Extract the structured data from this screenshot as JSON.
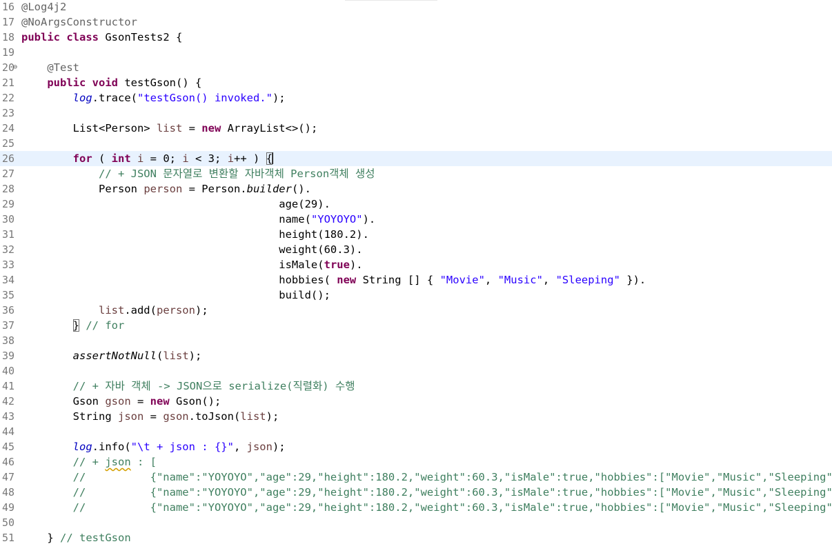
{
  "editor": {
    "lines": [
      {
        "num": "16",
        "tokens": [
          {
            "t": "@Log4j2",
            "c": "ann"
          }
        ]
      },
      {
        "num": "17",
        "tokens": [
          {
            "t": "@NoArgsConstructor",
            "c": "ann"
          }
        ]
      },
      {
        "num": "18",
        "tokens": [
          {
            "t": "public",
            "c": "kw"
          },
          {
            "t": " "
          },
          {
            "t": "class",
            "c": "kw"
          },
          {
            "t": " GsonTests2 {"
          }
        ]
      },
      {
        "num": "19",
        "tokens": []
      },
      {
        "num": "20",
        "fold": true,
        "tokens": [
          {
            "t": "    "
          },
          {
            "t": "@Test",
            "c": "ann"
          }
        ]
      },
      {
        "num": "21",
        "tokens": [
          {
            "t": "    "
          },
          {
            "t": "public",
            "c": "kw"
          },
          {
            "t": " "
          },
          {
            "t": "void",
            "c": "kw"
          },
          {
            "t": " testGson() {"
          }
        ]
      },
      {
        "num": "22",
        "tokens": [
          {
            "t": "        "
          },
          {
            "t": "log",
            "c": "fld"
          },
          {
            "t": ".trace("
          },
          {
            "t": "\"testGson() invoked.\"",
            "c": "str"
          },
          {
            "t": ");"
          }
        ]
      },
      {
        "num": "23",
        "tokens": []
      },
      {
        "num": "24",
        "tokens": [
          {
            "t": "        List<Person> "
          },
          {
            "t": "list",
            "c": "loc"
          },
          {
            "t": " = "
          },
          {
            "t": "new",
            "c": "kw"
          },
          {
            "t": " ArrayList<>();"
          }
        ]
      },
      {
        "num": "25",
        "tokens": []
      },
      {
        "num": "26",
        "current": true,
        "tokens": [
          {
            "t": "        "
          },
          {
            "t": "for",
            "c": "kw"
          },
          {
            "t": " ( "
          },
          {
            "t": "int",
            "c": "kw"
          },
          {
            "t": " "
          },
          {
            "t": "i",
            "c": "loc"
          },
          {
            "t": " = 0; "
          },
          {
            "t": "i",
            "c": "loc"
          },
          {
            "t": " < 3; "
          },
          {
            "t": "i",
            "c": "loc"
          },
          {
            "t": "++ ) "
          },
          {
            "t": "{",
            "c": "box"
          },
          {
            "t": "",
            "c": "caret"
          }
        ]
      },
      {
        "num": "27",
        "tokens": [
          {
            "t": "            "
          },
          {
            "t": "// + JSON 문자열로 변환할 자바객체 Person객체 생성",
            "c": "cmt"
          }
        ]
      },
      {
        "num": "28",
        "tokens": [
          {
            "t": "            Person "
          },
          {
            "t": "person",
            "c": "loc"
          },
          {
            "t": " = Person."
          },
          {
            "t": "builder",
            "c": "ital"
          },
          {
            "t": "()."
          }
        ]
      },
      {
        "num": "29",
        "tokens": [
          {
            "t": "                                        age(29)."
          }
        ]
      },
      {
        "num": "30",
        "tokens": [
          {
            "t": "                                        name("
          },
          {
            "t": "\"YOYOYO\"",
            "c": "str"
          },
          {
            "t": ")."
          }
        ]
      },
      {
        "num": "31",
        "tokens": [
          {
            "t": "                                        height(180.2)."
          }
        ]
      },
      {
        "num": "32",
        "tokens": [
          {
            "t": "                                        weight(60.3)."
          }
        ]
      },
      {
        "num": "33",
        "tokens": [
          {
            "t": "                                        isMale("
          },
          {
            "t": "true",
            "c": "kw"
          },
          {
            "t": ")."
          }
        ]
      },
      {
        "num": "34",
        "tokens": [
          {
            "t": "                                        hobbies( "
          },
          {
            "t": "new",
            "c": "kw"
          },
          {
            "t": " String [] { "
          },
          {
            "t": "\"Movie\"",
            "c": "str"
          },
          {
            "t": ", "
          },
          {
            "t": "\"Music\"",
            "c": "str"
          },
          {
            "t": ", "
          },
          {
            "t": "\"Sleeping\"",
            "c": "str"
          },
          {
            "t": " })."
          }
        ]
      },
      {
        "num": "35",
        "tokens": [
          {
            "t": "                                        build();"
          }
        ]
      },
      {
        "num": "36",
        "tokens": [
          {
            "t": "            "
          },
          {
            "t": "list",
            "c": "loc"
          },
          {
            "t": ".add("
          },
          {
            "t": "person",
            "c": "loc"
          },
          {
            "t": ");"
          }
        ]
      },
      {
        "num": "37",
        "tokens": [
          {
            "t": "        "
          },
          {
            "t": "}",
            "c": "box"
          },
          {
            "t": " "
          },
          {
            "t": "// for",
            "c": "cmt"
          }
        ]
      },
      {
        "num": "38",
        "tokens": []
      },
      {
        "num": "39",
        "tokens": [
          {
            "t": "        "
          },
          {
            "t": "assertNotNull",
            "c": "ital"
          },
          {
            "t": "("
          },
          {
            "t": "list",
            "c": "loc"
          },
          {
            "t": ");"
          }
        ]
      },
      {
        "num": "40",
        "tokens": []
      },
      {
        "num": "41",
        "tokens": [
          {
            "t": "        "
          },
          {
            "t": "// + 자바 객체 -> JSON으로 serialize(직렬화) 수행",
            "c": "cmt"
          }
        ]
      },
      {
        "num": "42",
        "tokens": [
          {
            "t": "        Gson "
          },
          {
            "t": "gson",
            "c": "loc"
          },
          {
            "t": " = "
          },
          {
            "t": "new",
            "c": "kw"
          },
          {
            "t": " Gson();"
          }
        ]
      },
      {
        "num": "43",
        "tokens": [
          {
            "t": "        String "
          },
          {
            "t": "json",
            "c": "loc"
          },
          {
            "t": " = "
          },
          {
            "t": "gson",
            "c": "loc"
          },
          {
            "t": ".toJson("
          },
          {
            "t": "list",
            "c": "loc"
          },
          {
            "t": ");"
          }
        ]
      },
      {
        "num": "44",
        "tokens": []
      },
      {
        "num": "45",
        "tokens": [
          {
            "t": "        "
          },
          {
            "t": "log",
            "c": "fld"
          },
          {
            "t": ".info("
          },
          {
            "t": "\"\\t + json : {}\"",
            "c": "str"
          },
          {
            "t": ", "
          },
          {
            "t": "json",
            "c": "loc"
          },
          {
            "t": ");"
          }
        ]
      },
      {
        "num": "46",
        "tokens": [
          {
            "t": "        "
          },
          {
            "t": "// + ",
            "c": "cmt"
          },
          {
            "t": "json",
            "c": "cmt squig"
          },
          {
            "t": " : [",
            "c": "cmt"
          }
        ]
      },
      {
        "num": "47",
        "tokens": [
          {
            "t": "        "
          },
          {
            "t": "//          {\"name\":\"YOYOYO\",\"age\":29,\"height\":180.2,\"weight\":60.3,\"isMale\":true,\"hobbies\":[\"Movie\",\"Music\",\"Sleeping\"]},",
            "c": "cmt"
          }
        ]
      },
      {
        "num": "48",
        "tokens": [
          {
            "t": "        "
          },
          {
            "t": "//          {\"name\":\"YOYOYO\",\"age\":29,\"height\":180.2,\"weight\":60.3,\"isMale\":true,\"hobbies\":[\"Movie\",\"Music\",\"Sleeping\"]},",
            "c": "cmt"
          }
        ]
      },
      {
        "num": "49",
        "tokens": [
          {
            "t": "        "
          },
          {
            "t": "//          {\"name\":\"YOYOYO\",\"age\":29,\"height\":180.2,\"weight\":60.3,\"isMale\":true,\"hobbies\":[\"Movie\",\"Music\",\"Sleeping\"]}]",
            "c": "cmt"
          }
        ]
      },
      {
        "num": "50",
        "tokens": []
      },
      {
        "num": "51",
        "tokens": [
          {
            "t": "    } "
          },
          {
            "t": "// testGson",
            "c": "cmt"
          }
        ]
      }
    ]
  }
}
